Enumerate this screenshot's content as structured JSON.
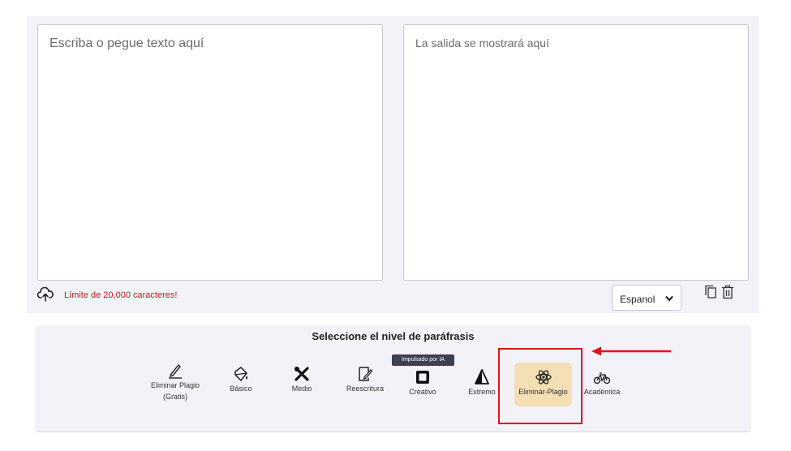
{
  "editor": {
    "input_placeholder": "Escriba o pegue texto aquí",
    "output_placeholder": "La salida se mostrará aquí",
    "char_limit": "Límite de 20,000 caracteres!",
    "language": "Espanol",
    "icons": [
      "upload-cloud-icon",
      "chevron-down-icon",
      "copy-icon",
      "trash-icon"
    ]
  },
  "levels": {
    "title": "Seleccione el nivel de paráfrasis",
    "ai_badge": "Impulsado por IA",
    "modes": [
      {
        "line1": "Eliminar Plagio",
        "line2": "(Gratis)",
        "icon": "pen-icon"
      },
      {
        "line1": "Básico",
        "icon": "paint-bucket-icon"
      },
      {
        "line1": "Medio",
        "icon": "tools-icon"
      },
      {
        "line1": "Reescritura",
        "icon": "rewrite-icon"
      },
      {
        "line1": "Creativo",
        "icon": "frame-icon"
      },
      {
        "line1": "Extremo",
        "icon": "prism-icon"
      },
      {
        "line1": "Eliminar-Plagio",
        "icon": "atom-icon",
        "selected": true
      },
      {
        "line1": "Académica",
        "icon": "bicycle-icon"
      }
    ]
  },
  "colors": {
    "accent_red": "#d6191b",
    "selected_bg": "#f5dfb4",
    "panel_bg": "#f3f2f8",
    "highlight": "#e0141a"
  }
}
